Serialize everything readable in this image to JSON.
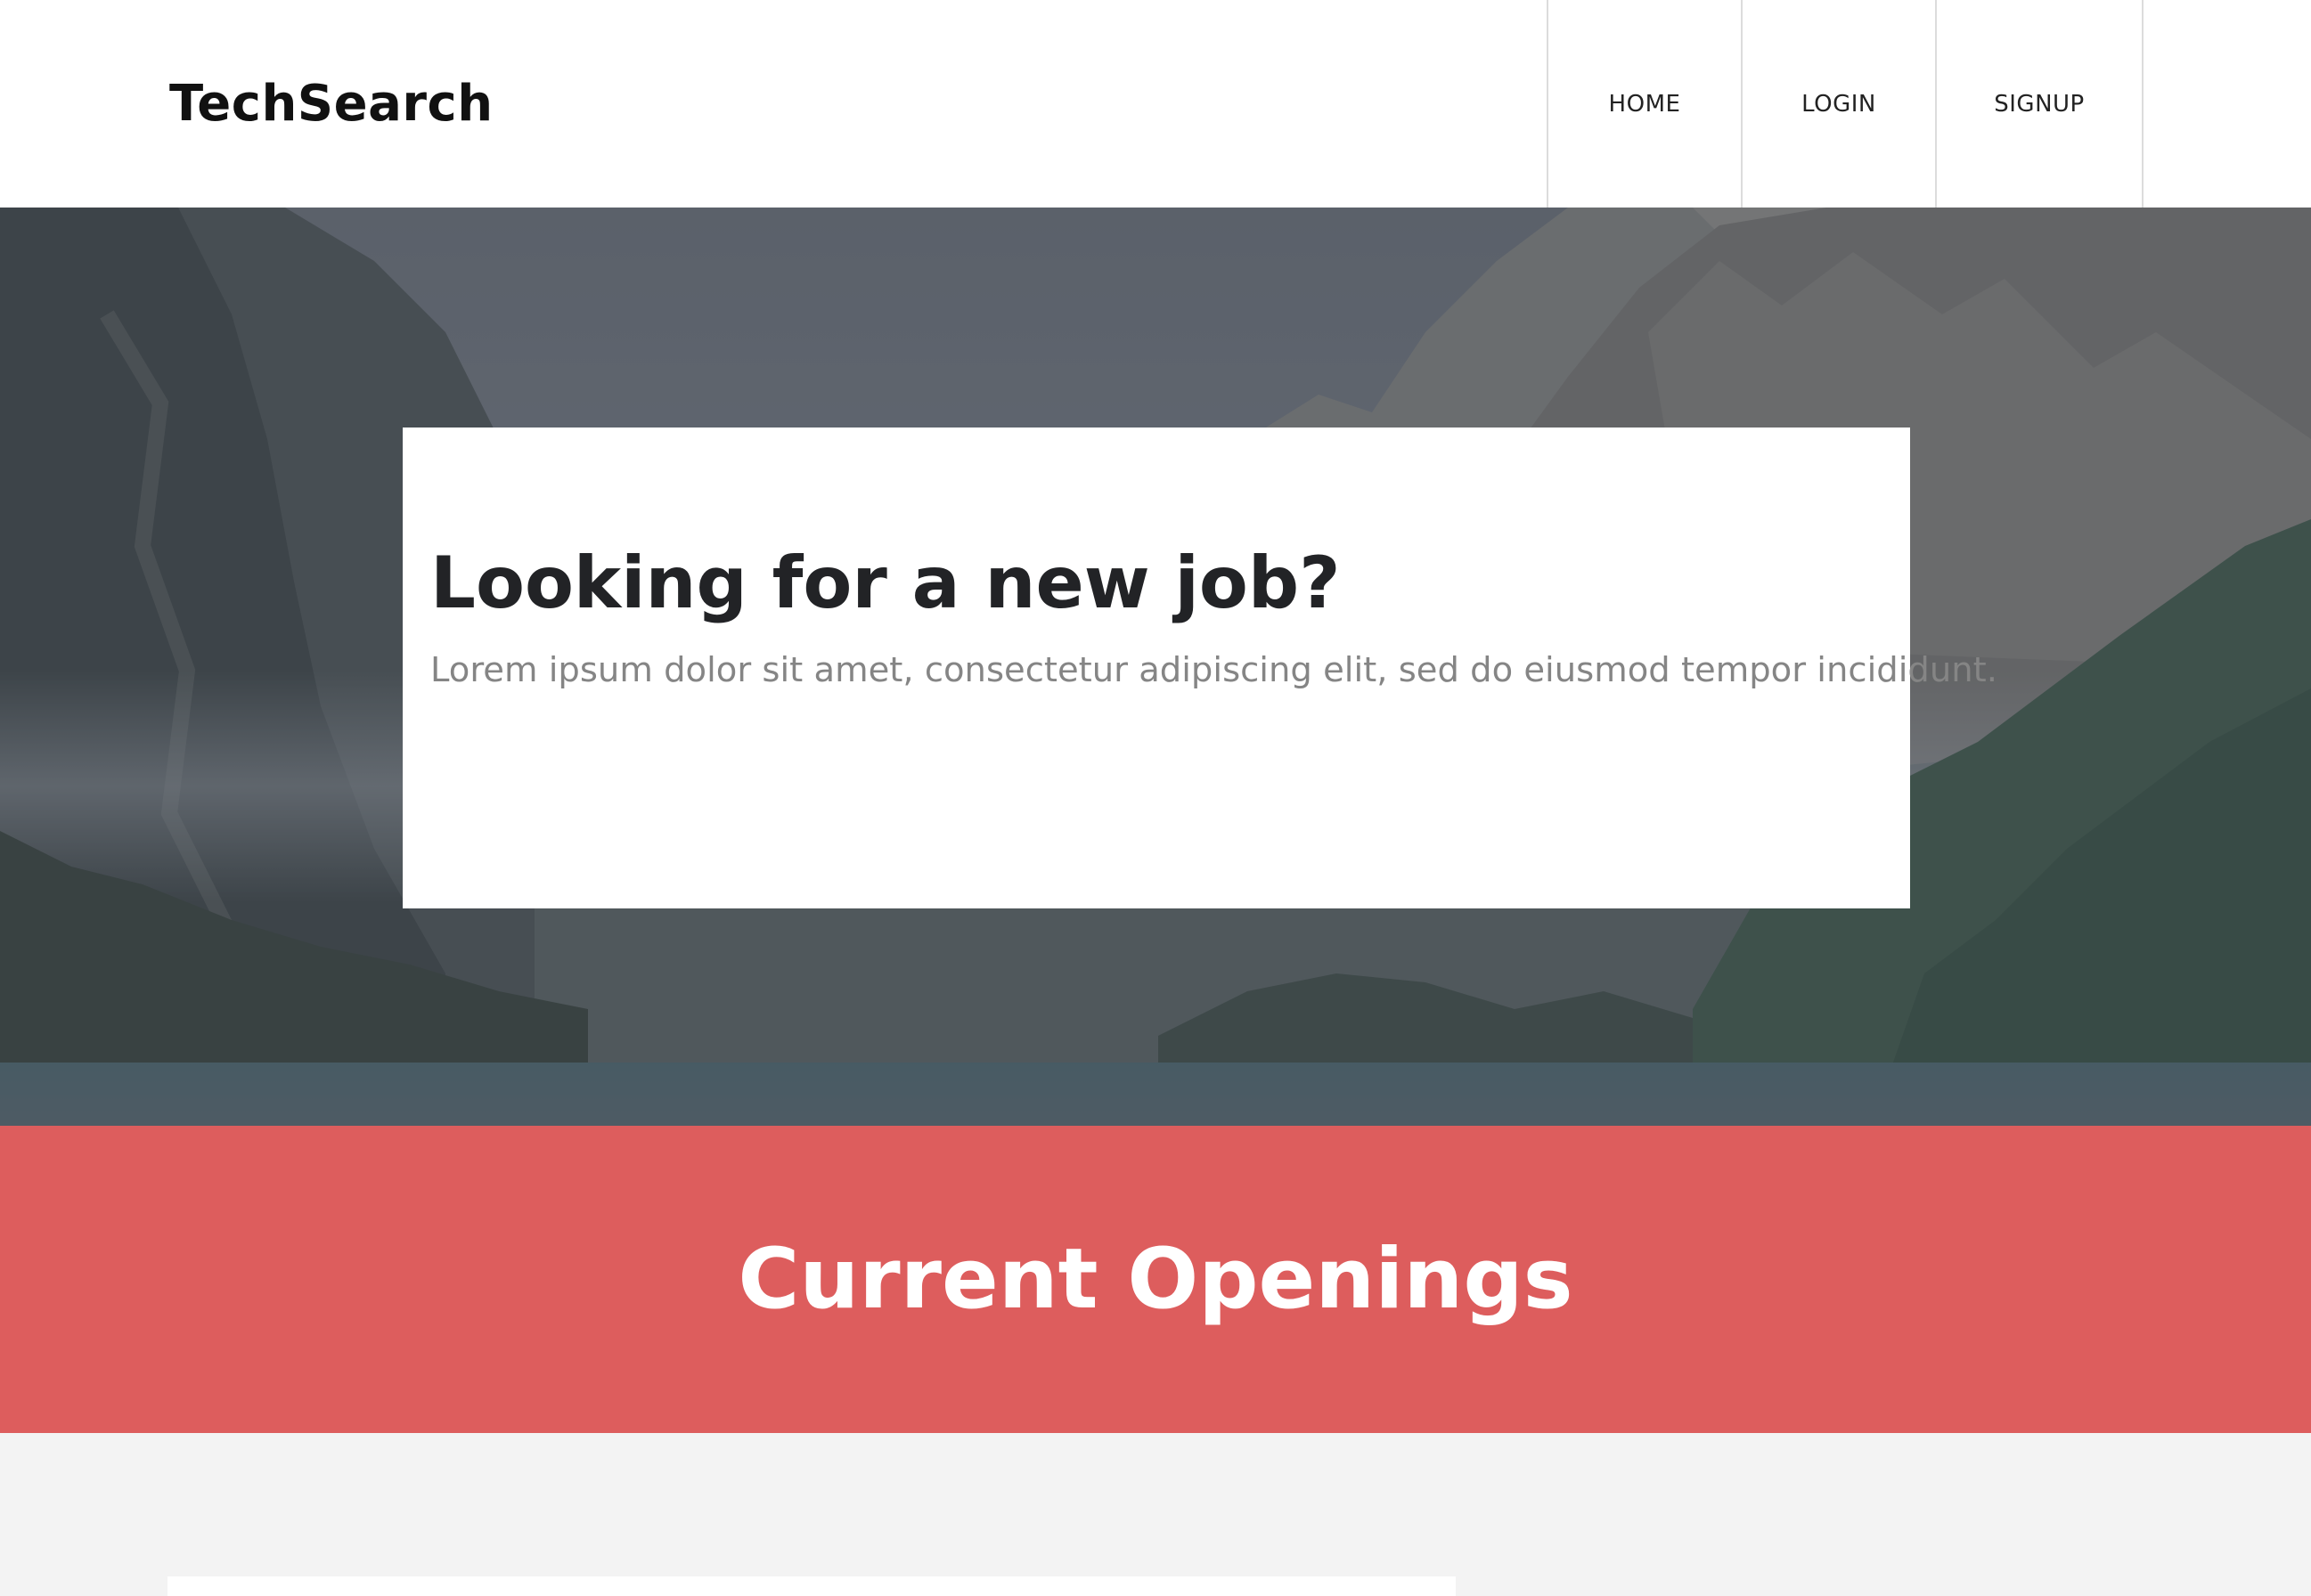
{
  "header": {
    "brand": "TechSearch",
    "nav": [
      {
        "label": "HOME"
      },
      {
        "label": "LOGIN"
      },
      {
        "label": "SIGNUP"
      }
    ]
  },
  "hero": {
    "title": "Looking for a new job?",
    "subtitle": "Lorem ipsum dolor sit amet, consectetur adipiscing elit, sed do eiusmod tempor incididunt."
  },
  "openings": {
    "title": "Current Openings"
  },
  "colors": {
    "header_bg": "#ffffff",
    "accent_banner": "#dd5d5d",
    "page_bg": "#f3f3f3",
    "hero_title": "#222326",
    "hero_subtitle": "#858585"
  },
  "icons": {
    "hero_background": "mountain-lake-landscape-image"
  }
}
